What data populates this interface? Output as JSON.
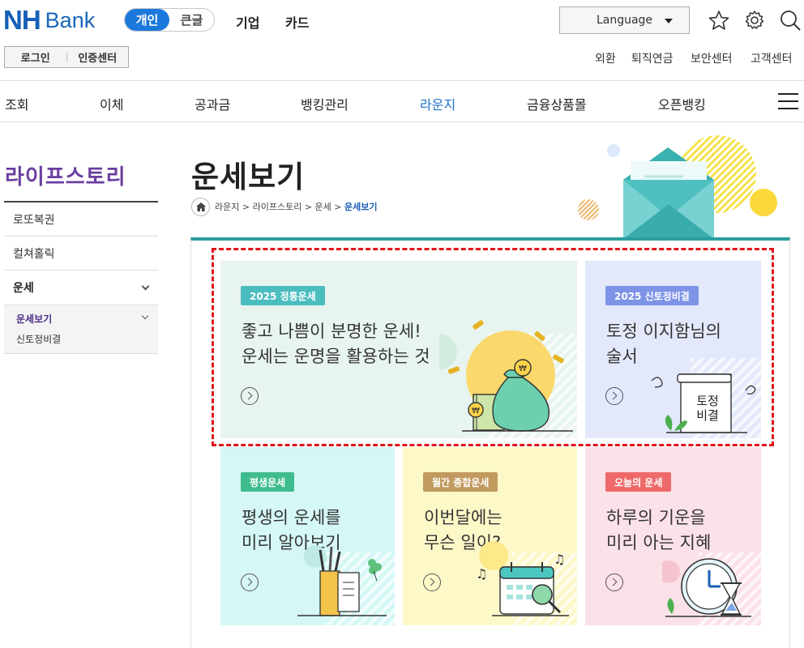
{
  "header": {
    "logo": {
      "mark": "NH",
      "text": "Bank"
    },
    "segment": {
      "active": "개인",
      "inactive": "큰글"
    },
    "top_nav": [
      "기업",
      "카드"
    ],
    "language": {
      "label": "Language"
    },
    "icons": [
      "star-icon",
      "gear-icon",
      "search-icon"
    ],
    "login": {
      "login_label": "로그인",
      "cert_label": "인증센터"
    },
    "utility": [
      "외환",
      "퇴직연금",
      "보안센터",
      "고객센터"
    ]
  },
  "gnb": {
    "items": [
      "조회",
      "이체",
      "공과금",
      "뱅킹관리",
      "라운지",
      "금융상품몰",
      "오픈뱅킹"
    ],
    "active": "라운지"
  },
  "sidebar": {
    "title": "라이프스토리",
    "items": [
      "로또복권",
      "컬쳐홀릭",
      "운세"
    ],
    "sub_active": "운세보기",
    "sub_items": [
      "신토정비결"
    ]
  },
  "page": {
    "title": "운세보기",
    "breadcrumb": [
      "라운지",
      "라이프스토리",
      "운세",
      "운세보기"
    ]
  },
  "cards": [
    {
      "badge": "2025 정통운세",
      "line1": "좋고 나쁨이 분명한 운세!",
      "line2": "운세는 운명을 활용하는 것",
      "badge_color": "#4cbdbf",
      "bg": "#e8f4ef"
    },
    {
      "badge": "2025 신토정비결",
      "line1": "토정 이지함님의",
      "line2": "술서",
      "badge_color": "#7d93e6",
      "bg": "#e3e9fb",
      "book_text_1": "토정",
      "book_text_2": "비결"
    },
    {
      "badge": "평생운세",
      "line1": "평생의 운세를",
      "line2": "미리 알아보기",
      "badge_color": "#3fbc8e",
      "bg": "#d5f7f6"
    },
    {
      "badge": "월간 종합운세",
      "line1": "이번달에는",
      "line2": "무슨 일이?",
      "badge_color": "#c19a5f",
      "bg": "#fdf8c8"
    },
    {
      "badge": "오늘의 운세",
      "line1": "하루의 기운을",
      "line2": "미리 아는 지혜",
      "badge_color": "#ee6a6a",
      "bg": "#fbe1e8"
    }
  ],
  "colors": {
    "brand": "#1560b6",
    "accent_teal": "#2c9ea0",
    "highlight_dash": "#e0141b",
    "side_title": "#6a3fa0"
  }
}
